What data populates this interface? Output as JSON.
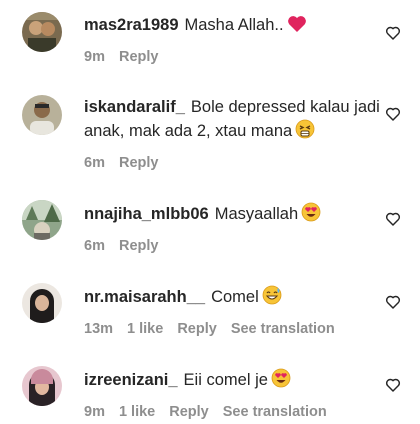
{
  "comments": [
    {
      "username": "mas2ra1989",
      "text": "Masha Allah..",
      "emoji": "red-heart",
      "time": "9m",
      "reply": "Reply"
    },
    {
      "username": "iskandaralif_",
      "text": "Bole depressed kalau jadi anak, mak ada 2, xtau mana",
      "emoji": "tired-face",
      "time": "6m",
      "reply": "Reply"
    },
    {
      "username": "nnajiha_mlbb06",
      "text": "Masyaallah",
      "emoji": "heart-eyes",
      "time": "6m",
      "reply": "Reply"
    },
    {
      "username": "nr.maisarahh__",
      "text": "Comel",
      "emoji": "grinning-sweat",
      "time": "13m",
      "likes": "1 like",
      "reply": "Reply",
      "translation": "See translation"
    },
    {
      "username": "izreenizani_",
      "text": "Eii comel je",
      "emoji": "heart-eyes",
      "time": "9m",
      "likes": "1 like",
      "reply": "Reply",
      "translation": "See translation"
    }
  ],
  "icons": {
    "like": "heart-outline-icon"
  },
  "colors": {
    "meta": "#8e8e8e",
    "text": "#262626"
  }
}
